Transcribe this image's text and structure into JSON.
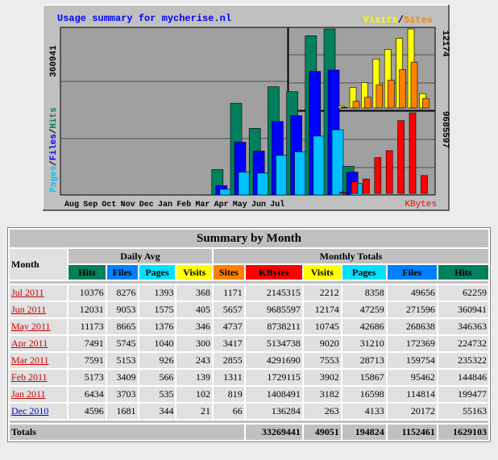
{
  "graph": {
    "title": "Usage summary for mycherise.nl",
    "legend_visits": "Visits",
    "legend_sep": "/",
    "legend_sites": "Sites",
    "left_axis_max": "360941",
    "left_axis_label": {
      "pages": "Pages",
      "files": "Files",
      "hits": "Hits",
      "sep": "/"
    },
    "right_top_max": "12174",
    "right_bottom_max": "9685597",
    "right_bottom_label": "KBytes",
    "months": [
      "Aug",
      "Sep",
      "Oct",
      "Nov",
      "Dec",
      "Jan",
      "Feb",
      "Mar",
      "Apr",
      "May",
      "Jun",
      "Jul"
    ]
  },
  "chart_data": [
    {
      "type": "bar",
      "categories": [
        "Aug",
        "Sep",
        "Oct",
        "Nov",
        "Dec",
        "Jan",
        "Feb",
        "Mar",
        "Apr",
        "May",
        "Jun",
        "Jul"
      ],
      "series": [
        {
          "name": "Hits",
          "values": [
            0,
            0,
            0,
            0,
            55163,
            199477,
            144846,
            235322,
            224732,
            346363,
            360941,
            62259
          ]
        },
        {
          "name": "Files",
          "values": [
            0,
            0,
            0,
            0,
            20172,
            114814,
            95462,
            159754,
            172369,
            268638,
            271596,
            49656
          ]
        },
        {
          "name": "Pages",
          "values": [
            0,
            0,
            0,
            0,
            4133,
            16598,
            15867,
            28713,
            31210,
            42686,
            47259,
            8358
          ]
        }
      ],
      "ylim": [
        0,
        360941
      ]
    },
    {
      "type": "bar",
      "categories": [
        "Aug",
        "Sep",
        "Oct",
        "Nov",
        "Dec",
        "Jan",
        "Feb",
        "Mar",
        "Apr",
        "May",
        "Jun",
        "Jul"
      ],
      "series": [
        {
          "name": "Visits",
          "values": [
            0,
            0,
            0,
            0,
            263,
            3182,
            3902,
            7553,
            9020,
            10745,
            12174,
            2212
          ]
        },
        {
          "name": "Sites",
          "values": [
            0,
            0,
            0,
            0,
            66,
            819,
            1311,
            2855,
            3417,
            4737,
            5657,
            1171
          ]
        }
      ],
      "ylim": [
        0,
        12174
      ]
    },
    {
      "type": "bar",
      "categories": [
        "Aug",
        "Sep",
        "Oct",
        "Nov",
        "Dec",
        "Jan",
        "Feb",
        "Mar",
        "Apr",
        "May",
        "Jun",
        "Jul"
      ],
      "series": [
        {
          "name": "KBytes",
          "values": [
            0,
            0,
            0,
            0,
            136284,
            1408491,
            1729115,
            4291690,
            5134738,
            8738211,
            9685597,
            2145315
          ]
        }
      ],
      "ylim": [
        0,
        9685597
      ]
    }
  ],
  "colors": {
    "hits": "#00805c",
    "files": "#0000ff",
    "pages": "#00c0ff",
    "visits": "#ffff00",
    "sites": "#ff8000",
    "kbytes": "#ff0000",
    "link_red": "#cc0000",
    "link_blue": "#0000cc"
  },
  "table": {
    "title": "Summary by Month",
    "month_header": "Month",
    "daily_avg": "Daily Avg",
    "monthly_totals": "Monthly Totals",
    "cols_daily": [
      "Hits",
      "Files",
      "Pages",
      "Visits"
    ],
    "cols_monthly": [
      "Sites",
      "KBytes",
      "Visits",
      "Pages",
      "Files",
      "Hits"
    ],
    "rows": [
      {
        "month": "Jul 2011",
        "cells": [
          "10376",
          "8276",
          "1393",
          "368",
          "1171",
          "2145315",
          "2212",
          "8358",
          "49656",
          "62259"
        ]
      },
      {
        "month": "Jun 2011",
        "cells": [
          "12031",
          "9053",
          "1575",
          "405",
          "5657",
          "9685597",
          "12174",
          "47259",
          "271596",
          "360941"
        ]
      },
      {
        "month": "May 2011",
        "cells": [
          "11173",
          "8665",
          "1376",
          "346",
          "4737",
          "8738211",
          "10745",
          "42686",
          "268638",
          "346363"
        ]
      },
      {
        "month": "Apr 2011",
        "cells": [
          "7491",
          "5745",
          "1040",
          "300",
          "3417",
          "5134738",
          "9020",
          "31210",
          "172369",
          "224732"
        ]
      },
      {
        "month": "Mar 2011",
        "cells": [
          "7591",
          "5153",
          "926",
          "243",
          "2855",
          "4291690",
          "7553",
          "28713",
          "159754",
          "235322"
        ]
      },
      {
        "month": "Feb 2011",
        "cells": [
          "5173",
          "3409",
          "566",
          "139",
          "1311",
          "1729115",
          "3902",
          "15867",
          "95462",
          "144846"
        ]
      },
      {
        "month": "Jan 2011",
        "cells": [
          "6434",
          "3703",
          "535",
          "102",
          "819",
          "1408491",
          "3182",
          "16598",
          "114814",
          "199477"
        ]
      },
      {
        "month": "Dec 2010",
        "cells": [
          "4596",
          "1681",
          "344",
          "21",
          "66",
          "136284",
          "263",
          "4133",
          "20172",
          "55163"
        ]
      }
    ],
    "totals_label": "Totals",
    "totals": [
      "33269441",
      "49051",
      "194824",
      "1152461",
      "1629103"
    ]
  }
}
